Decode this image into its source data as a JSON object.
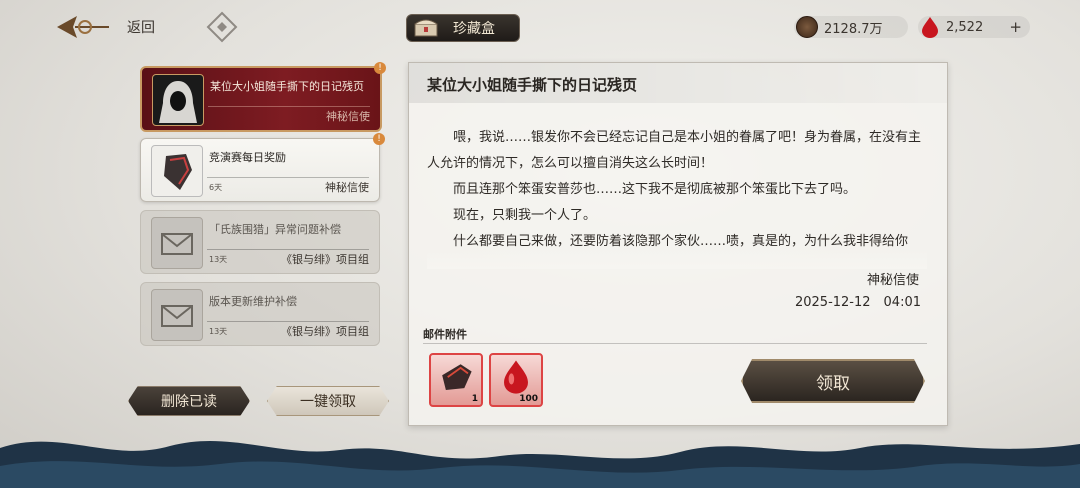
{
  "header": {
    "back_label": "返回",
    "treasure_label": "珍藏盒",
    "currency_coins": "2128.7万",
    "currency_gems": "2,522",
    "plus_label": "+"
  },
  "mail_list": [
    {
      "title": "某位大小姐随手撕下的日记残页",
      "days": "",
      "sender": "神秘信使",
      "badge": "!",
      "selected": true
    },
    {
      "title": "竞演赛每日奖励",
      "days": "6天",
      "sender": "神秘信使",
      "badge": "!"
    },
    {
      "title": "「氏族围猎」异常问题补偿",
      "days": "13天",
      "sender": "《银与绯》项目组"
    },
    {
      "title": "版本更新维护补偿",
      "days": "13天",
      "sender": "《银与绯》项目组"
    }
  ],
  "actions": {
    "delete_read": "删除已读",
    "claim_all": "一键领取"
  },
  "detail": {
    "title": "某位大小姐随手撕下的日记残页",
    "paragraphs": [
      "喂，我说……银发你不会已经忘记自己是本小姐的眷属了吧！身为眷属，在没有主人允许的情况下，怎么可以擅自消失这么长时间！",
      "而且连那个笨蛋安普莎也……这下我不是彻底被那个笨蛋比下去了吗。",
      "现在，只剩我一个人了。",
      "什么都要自己来做，还要防着该隐那个家伙……啧，真是的，为什么我非得给你"
    ],
    "sender": "神秘信使",
    "date": "2025-12-12　04:01",
    "attachments_label": "邮件附件",
    "attachments": [
      {
        "icon": "crest-shard-icon",
        "qty": "1"
      },
      {
        "icon": "blood-gem-icon",
        "qty": "100"
      }
    ],
    "claim_label": "领取"
  },
  "colors": {
    "accent_red": "#7e1c22",
    "gold_border": "#c89a62",
    "dark_button": "#2a2420"
  }
}
